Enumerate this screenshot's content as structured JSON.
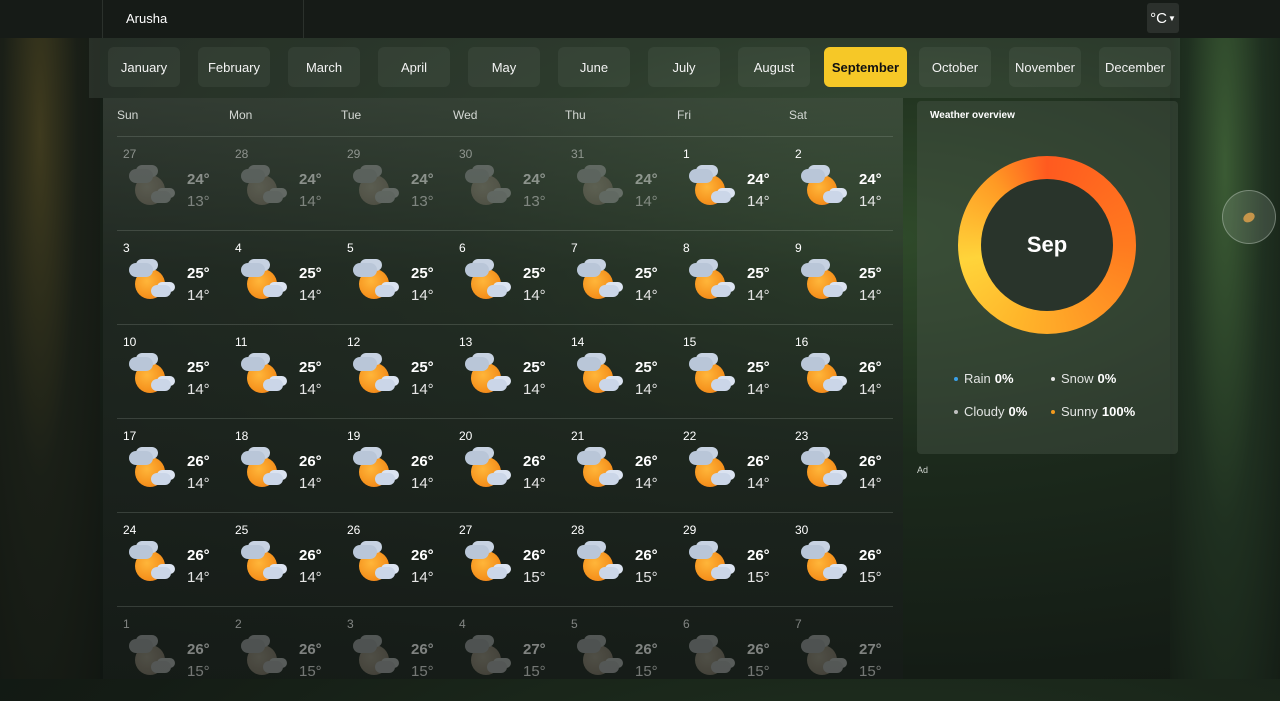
{
  "header": {
    "location": "Arusha",
    "unit_label": "°C"
  },
  "months": [
    "January",
    "February",
    "March",
    "April",
    "May",
    "June",
    "July",
    "August",
    "September",
    "October",
    "November",
    "December"
  ],
  "active_month_index": 8,
  "weekdays": [
    "Sun",
    "Mon",
    "Tue",
    "Wed",
    "Thu",
    "Fri",
    "Sat"
  ],
  "days": [
    {
      "d": "27",
      "hi": "24°",
      "lo": "13°",
      "dim": true
    },
    {
      "d": "28",
      "hi": "24°",
      "lo": "14°",
      "dim": true
    },
    {
      "d": "29",
      "hi": "24°",
      "lo": "13°",
      "dim": true
    },
    {
      "d": "30",
      "hi": "24°",
      "lo": "13°",
      "dim": true
    },
    {
      "d": "31",
      "hi": "24°",
      "lo": "14°",
      "dim": true
    },
    {
      "d": "1",
      "hi": "24°",
      "lo": "14°",
      "dim": false
    },
    {
      "d": "2",
      "hi": "24°",
      "lo": "14°",
      "dim": false
    },
    {
      "d": "3",
      "hi": "25°",
      "lo": "14°",
      "dim": false
    },
    {
      "d": "4",
      "hi": "25°",
      "lo": "14°",
      "dim": false
    },
    {
      "d": "5",
      "hi": "25°",
      "lo": "14°",
      "dim": false
    },
    {
      "d": "6",
      "hi": "25°",
      "lo": "14°",
      "dim": false
    },
    {
      "d": "7",
      "hi": "25°",
      "lo": "14°",
      "dim": false
    },
    {
      "d": "8",
      "hi": "25°",
      "lo": "14°",
      "dim": false
    },
    {
      "d": "9",
      "hi": "25°",
      "lo": "14°",
      "dim": false
    },
    {
      "d": "10",
      "hi": "25°",
      "lo": "14°",
      "dim": false
    },
    {
      "d": "11",
      "hi": "25°",
      "lo": "14°",
      "dim": false
    },
    {
      "d": "12",
      "hi": "25°",
      "lo": "14°",
      "dim": false
    },
    {
      "d": "13",
      "hi": "25°",
      "lo": "14°",
      "dim": false
    },
    {
      "d": "14",
      "hi": "25°",
      "lo": "14°",
      "dim": false
    },
    {
      "d": "15",
      "hi": "25°",
      "lo": "14°",
      "dim": false
    },
    {
      "d": "16",
      "hi": "26°",
      "lo": "14°",
      "dim": false
    },
    {
      "d": "17",
      "hi": "26°",
      "lo": "14°",
      "dim": false
    },
    {
      "d": "18",
      "hi": "26°",
      "lo": "14°",
      "dim": false
    },
    {
      "d": "19",
      "hi": "26°",
      "lo": "14°",
      "dim": false
    },
    {
      "d": "20",
      "hi": "26°",
      "lo": "14°",
      "dim": false
    },
    {
      "d": "21",
      "hi": "26°",
      "lo": "14°",
      "dim": false
    },
    {
      "d": "22",
      "hi": "26°",
      "lo": "14°",
      "dim": false
    },
    {
      "d": "23",
      "hi": "26°",
      "lo": "14°",
      "dim": false
    },
    {
      "d": "24",
      "hi": "26°",
      "lo": "14°",
      "dim": false
    },
    {
      "d": "25",
      "hi": "26°",
      "lo": "14°",
      "dim": false
    },
    {
      "d": "26",
      "hi": "26°",
      "lo": "14°",
      "dim": false
    },
    {
      "d": "27",
      "hi": "26°",
      "lo": "15°",
      "dim": false
    },
    {
      "d": "28",
      "hi": "26°",
      "lo": "15°",
      "dim": false
    },
    {
      "d": "29",
      "hi": "26°",
      "lo": "15°",
      "dim": false
    },
    {
      "d": "30",
      "hi": "26°",
      "lo": "15°",
      "dim": false
    },
    {
      "d": "1",
      "hi": "26°",
      "lo": "15°",
      "dim": true
    },
    {
      "d": "2",
      "hi": "26°",
      "lo": "15°",
      "dim": true
    },
    {
      "d": "3",
      "hi": "26°",
      "lo": "15°",
      "dim": true
    },
    {
      "d": "4",
      "hi": "27°",
      "lo": "15°",
      "dim": true
    },
    {
      "d": "5",
      "hi": "26°",
      "lo": "15°",
      "dim": true
    },
    {
      "d": "6",
      "hi": "26°",
      "lo": "15°",
      "dim": true
    },
    {
      "d": "7",
      "hi": "27°",
      "lo": "15°",
      "dim": true
    }
  ],
  "day_icon": "sun-behind-cloud-icon",
  "overview": {
    "title": "Weather overview",
    "month_short": "Sep",
    "stats": [
      {
        "label": "Rain",
        "value": "0%",
        "color": "#3aa0e8"
      },
      {
        "label": "Snow",
        "value": "0%",
        "color": "#e8e8e8"
      },
      {
        "label": "Cloudy",
        "value": "0%",
        "color": "#c0c0c0"
      },
      {
        "label": "Sunny",
        "value": "100%",
        "color": "#f39a1e"
      }
    ]
  },
  "ad_label": "Ad",
  "colors": {
    "accent": "#f6c827",
    "ring_start": "#ff5a1f",
    "ring_end": "#ffd43a"
  }
}
